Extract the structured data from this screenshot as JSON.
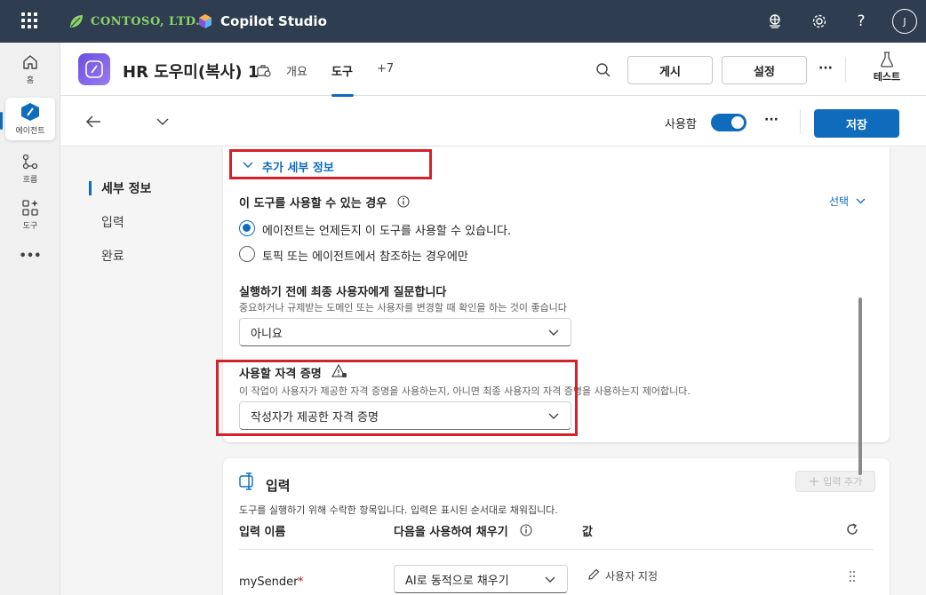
{
  "topbar": {
    "brand": "CONTOSO, LTD.",
    "product": "Copilot Studio",
    "avatar_initial": "J",
    "icons": [
      "waffle-icon",
      "environment-icon",
      "settings-icon",
      "help-icon"
    ],
    "help_glyph": "?"
  },
  "rail": {
    "items": [
      {
        "label": "홈",
        "icon": "home-icon"
      },
      {
        "label": "에이전트",
        "icon": "agent-icon"
      },
      {
        "label": "흐름",
        "icon": "flow-icon"
      },
      {
        "label": "도구",
        "icon": "tools-icon"
      }
    ],
    "more": "•••"
  },
  "header": {
    "title": "HR 도우미(복사) 1",
    "tabs": [
      {
        "label": "개요"
      },
      {
        "label": "도구"
      },
      {
        "label": "+7"
      }
    ],
    "publish_label": "게시",
    "settings_label": "설정",
    "more_label": "···",
    "test_label": "테스트"
  },
  "subheader": {
    "enabled_label": "사용함",
    "more_label": "···",
    "save_label": "저장"
  },
  "leftnav": {
    "items": [
      "세부 정보",
      "입력",
      "완료"
    ]
  },
  "details": {
    "section_title": "추가 세부 정보",
    "availability": {
      "label": "이 도구를 사용할 수 있는 경우",
      "select_link": "선택",
      "options": [
        {
          "label": "에이전트는 언제든지 이 도구를 사용할 수 있습니다.",
          "selected": true
        },
        {
          "label": "토픽 또는 에이전트에서 참조하는 경우에만",
          "selected": false
        }
      ]
    },
    "confirm": {
      "label": "실행하기 전에 최종 사용자에게 질문합니다",
      "hint": "중요하거나 규제받는 도메인 또는 사용자를 변경할 때 확인을 하는 것이 좋습니다",
      "value": "아니요"
    },
    "credentials": {
      "label": "사용할 자격 증명",
      "hint": "이 작업이 사용자가 제공한 자격 증명을 사용하는지, 아니면 최종 사용자의 자격 증명을 사용하는지 제어합니다.",
      "value": "작성자가 제공한 자격 증명"
    }
  },
  "inputs": {
    "title": "입력",
    "add_label": "입력 추가",
    "description": "도구를 실행하기 위해 수락한 항목입니다. 입력은 표시된 순서대로 채워집니다.",
    "columns": [
      "입력 이름",
      "다음을 사용하여 채우기",
      "값"
    ],
    "rows": [
      {
        "name": "mySender",
        "required": "*",
        "fill": "AI로 동적으로 채우기",
        "value": "사용자 지정"
      }
    ]
  },
  "colors": {
    "accent": "#0f6cbd",
    "topbar": "#2e3e50",
    "highlight": "#d4212c",
    "brand_green": "#8dd36a"
  }
}
